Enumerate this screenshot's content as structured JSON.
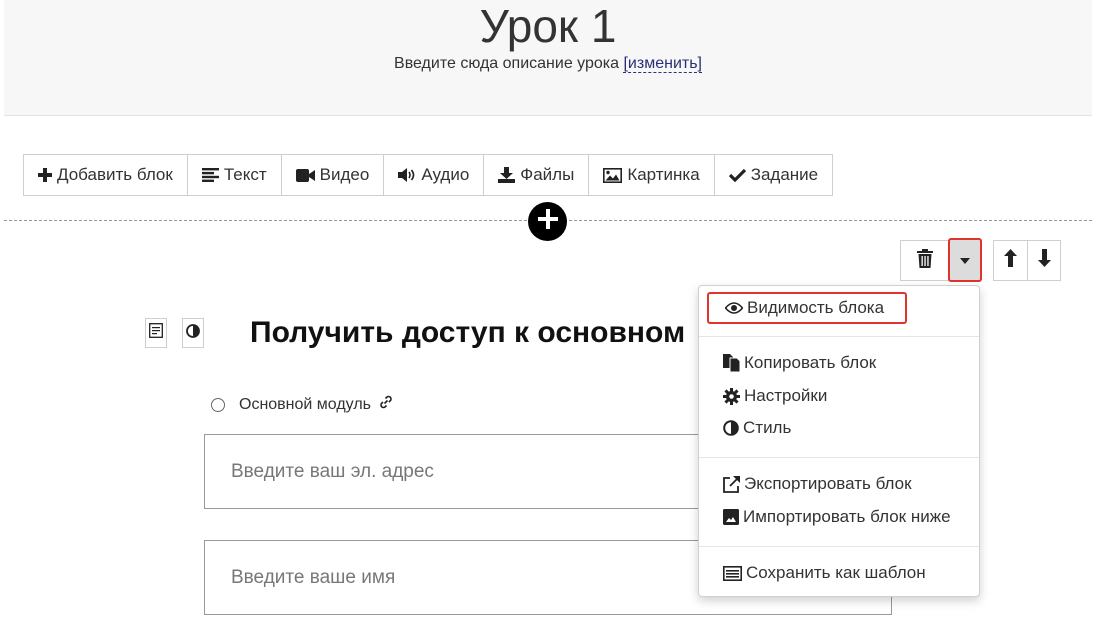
{
  "header": {
    "title": "Урок 1",
    "description": "Введите сюда описание урока",
    "edit_link": "[изменить]"
  },
  "toolbar": {
    "items": [
      {
        "label": "Добавить блок",
        "icon": "plus-icon"
      },
      {
        "label": "Текст",
        "icon": "align-left-icon"
      },
      {
        "label": "Видео",
        "icon": "video-camera-icon"
      },
      {
        "label": "Аудио",
        "icon": "volume-icon"
      },
      {
        "label": "Файлы",
        "icon": "download-icon"
      },
      {
        "label": "Картинка",
        "icon": "image-icon"
      },
      {
        "label": "Задание",
        "icon": "check-icon"
      }
    ]
  },
  "block": {
    "heading": "Получить доступ к основном",
    "radio_label": "Основной модуль",
    "email_placeholder": "Введите ваш эл. адрес",
    "name_placeholder": "Введите ваше имя"
  },
  "dropdown": {
    "items": [
      {
        "label": "Видимость блока",
        "icon": "eye-icon"
      },
      {
        "label": "Копировать блок",
        "icon": "copy-icon"
      },
      {
        "label": "Настройки",
        "icon": "gear-icon"
      },
      {
        "label": "Стиль",
        "icon": "contrast-icon"
      },
      {
        "label": "Экспортировать блок",
        "icon": "external-link-icon"
      },
      {
        "label": "Импортировать блок ниже",
        "icon": "import-image-icon"
      },
      {
        "label": "Сохранить как шаблон",
        "icon": "template-list-icon"
      }
    ]
  },
  "colors": {
    "highlight": "#e0332c",
    "link": "#2d2d7a",
    "header_bg": "#f7f7f7"
  }
}
